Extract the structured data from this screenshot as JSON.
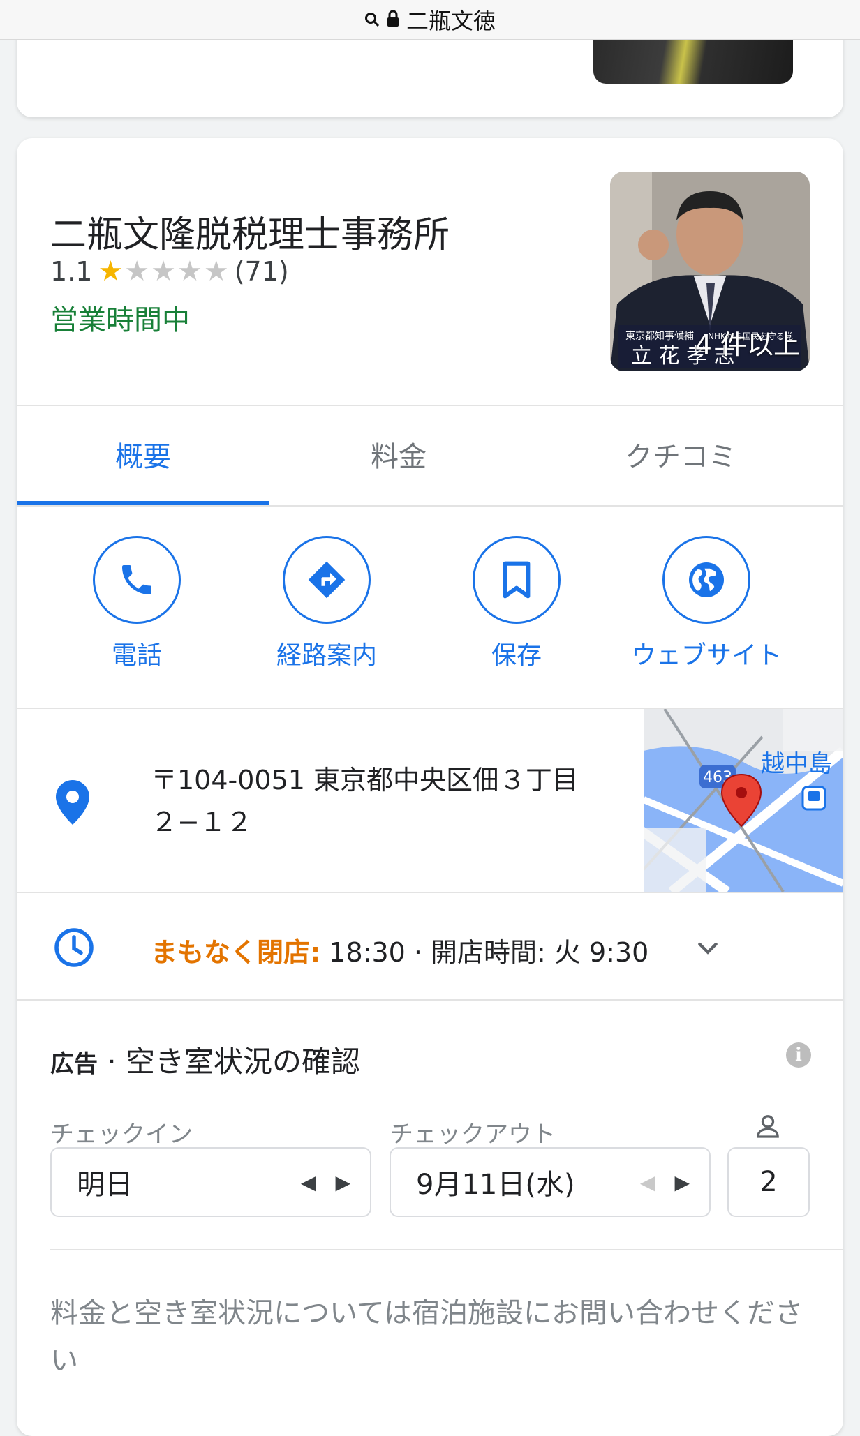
{
  "url_bar": {
    "text": "二瓶文徳",
    "icons": [
      "search-icon",
      "lock-icon"
    ]
  },
  "listing": {
    "title": "二瓶文隆脱税理士事務所",
    "rating": "1.1",
    "stars": 1,
    "stars_max": 5,
    "review_count": "(71)",
    "status": "営業時間中",
    "photo_more": "4 件以上",
    "photo_caption": "東京都知事候補 NHKから国民を守る党 立花孝志"
  },
  "tabs": [
    {
      "label": "概要",
      "active": true
    },
    {
      "label": "料金",
      "active": false
    },
    {
      "label": "クチコミ",
      "active": false
    }
  ],
  "actions": [
    {
      "label": "電話",
      "icon": "phone-icon"
    },
    {
      "label": "経路案内",
      "icon": "directions-icon"
    },
    {
      "label": "保存",
      "icon": "bookmark-icon"
    },
    {
      "label": "ウェブサイト",
      "icon": "globe-icon"
    }
  ],
  "address": {
    "line1": "〒104-0051 東京都中央区佃３丁目",
    "line2": "２−１２",
    "map_label": "越中島",
    "map_route": "463"
  },
  "hours": {
    "warning": "まもなく閉店:",
    "detail": " 18:30 · 開店時間: 火 9:30"
  },
  "ad": {
    "prefix": "広告",
    "title": " · 空き室状況の確認",
    "checkin_label": "チェックイン",
    "checkin_value": "明日",
    "checkout_label": "チェックアウト",
    "checkout_value": "9月11日(水)",
    "guests": "2",
    "note": "料金と空き室状況については宿泊施設にお問い合わせください"
  },
  "colors": {
    "accent": "#1a73e8",
    "open": "#188038",
    "warning": "#e37400",
    "star": "#f6b500"
  }
}
